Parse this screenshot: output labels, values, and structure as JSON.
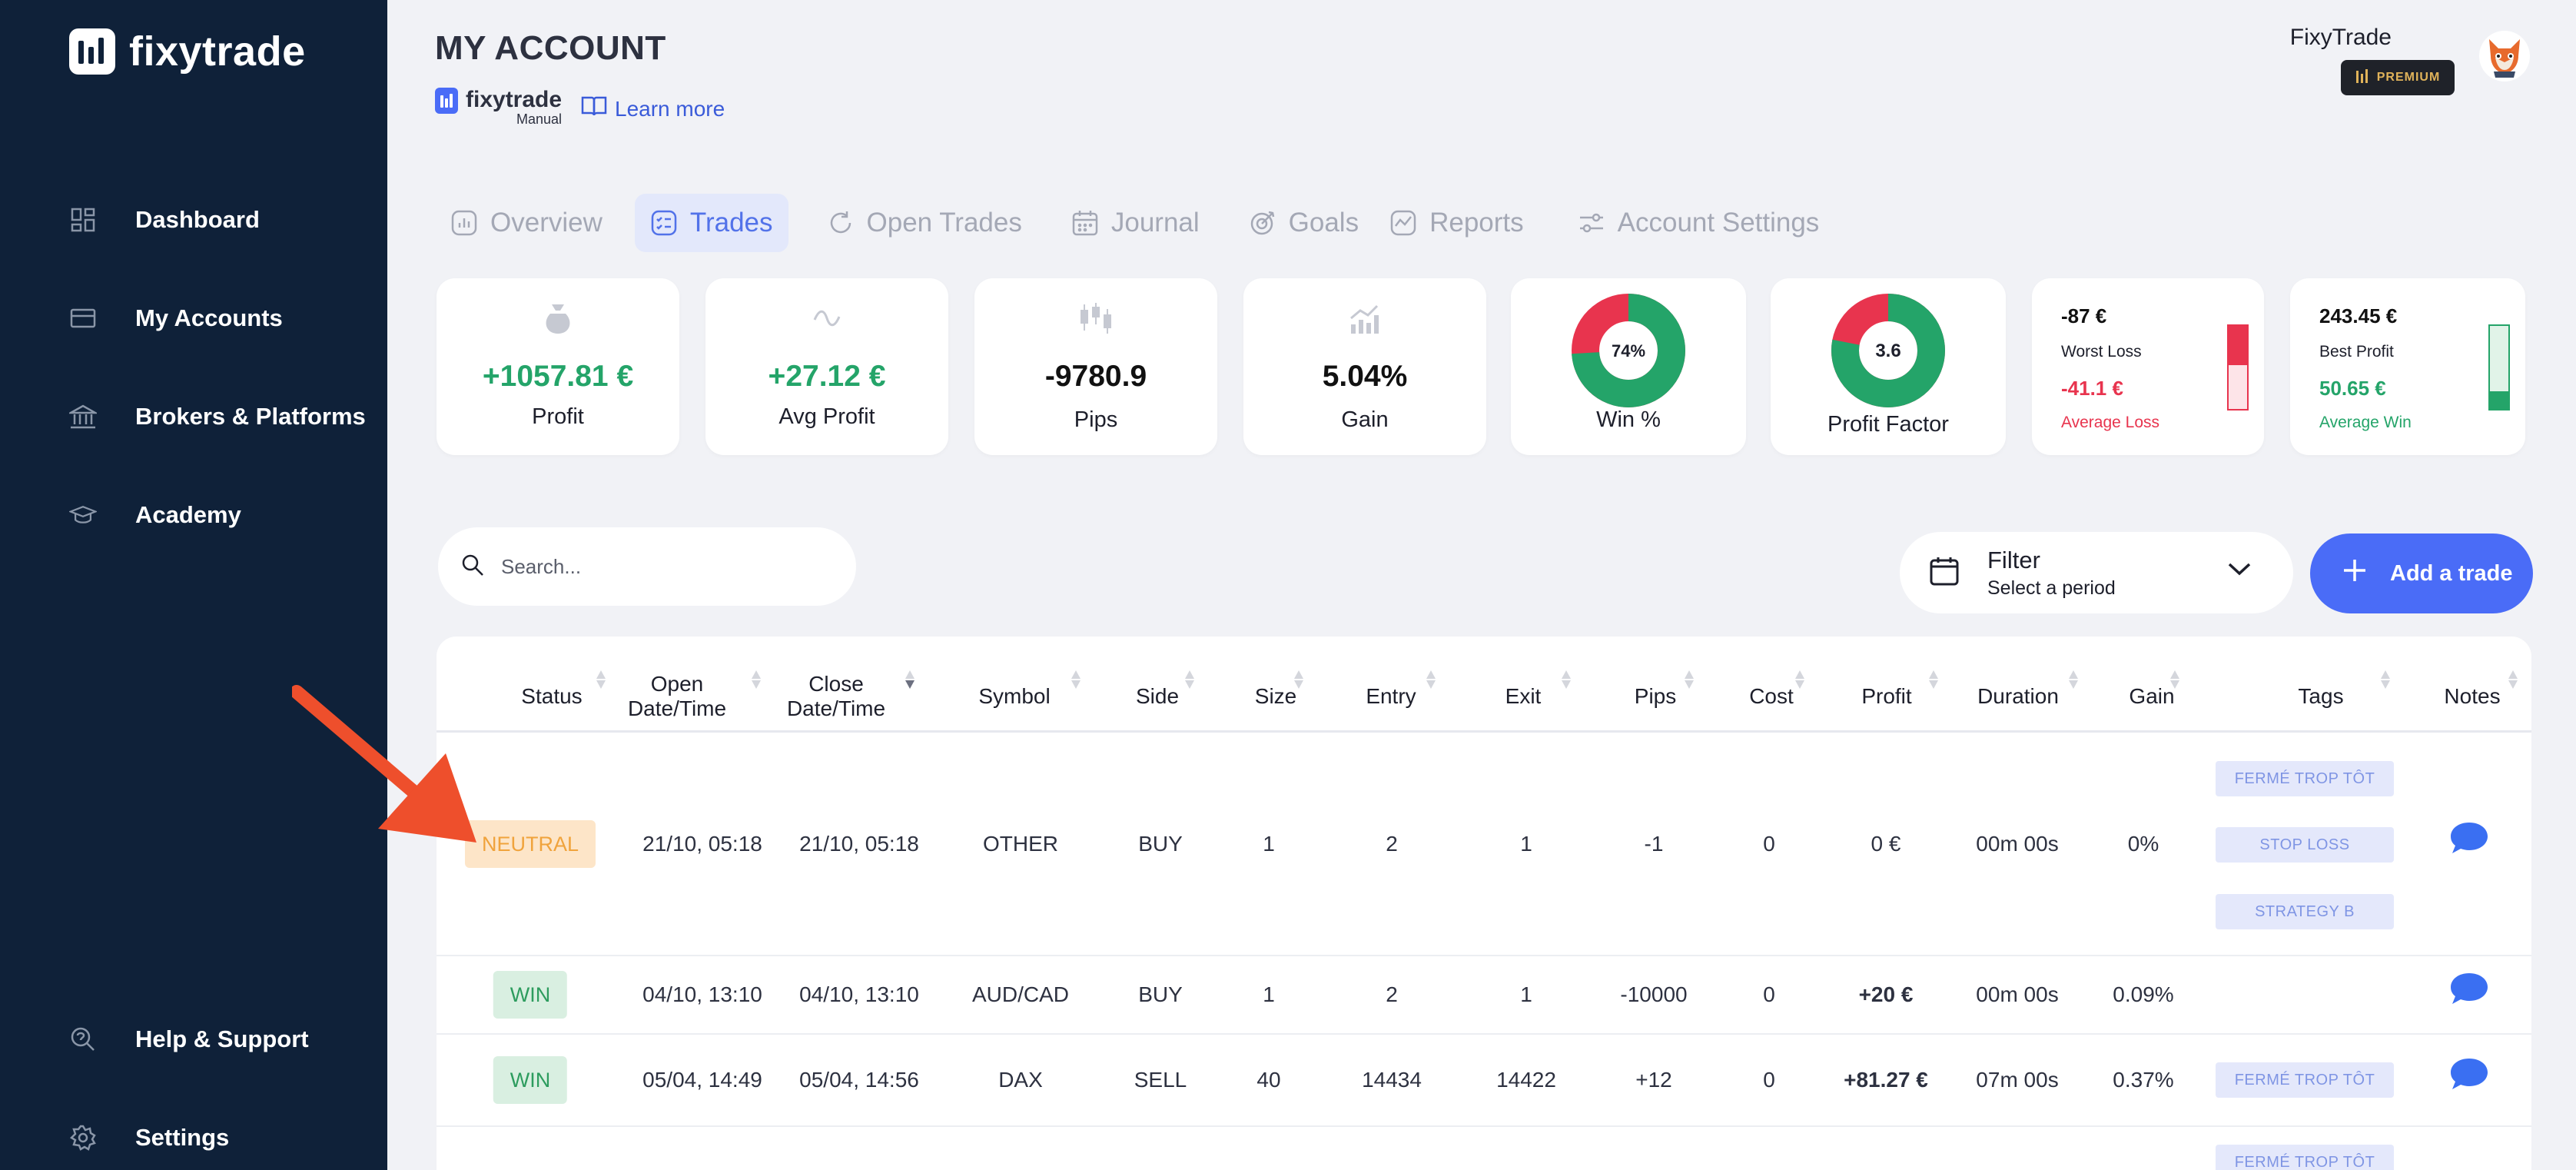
{
  "brand": {
    "name": "fixytrade"
  },
  "sidebar": {
    "items": [
      {
        "label": "Dashboard",
        "icon": "dashboard-icon"
      },
      {
        "label": "My Accounts",
        "icon": "accounts-icon"
      },
      {
        "label": "Brokers & Platforms",
        "icon": "bank-icon"
      },
      {
        "label": "Academy",
        "icon": "graduation-cap-icon"
      },
      {
        "label": "Help & Support",
        "icon": "support-icon"
      },
      {
        "label": "Settings",
        "icon": "gear-icon"
      }
    ]
  },
  "header": {
    "title": "MY ACCOUNT",
    "sub_brand_name": "fixytrade",
    "sub_brand_mode": "Manual",
    "learn_more": "Learn more",
    "user_name": "FixyTrade",
    "badge": "PREMIUM"
  },
  "tabs": [
    {
      "label": "Overview",
      "active": false
    },
    {
      "label": "Trades",
      "active": true
    },
    {
      "label": "Open Trades",
      "active": false
    },
    {
      "label": "Journal",
      "active": false
    },
    {
      "label": "Goals",
      "active": false
    },
    {
      "label": "Reports",
      "active": false
    },
    {
      "label": "Account Settings",
      "active": false
    }
  ],
  "stats": {
    "profit": {
      "value": "+1057.81 €",
      "label": "Profit"
    },
    "avg_profit": {
      "value": "+27.12 €",
      "label": "Avg Profit"
    },
    "pips": {
      "value": "-9780.9",
      "label": "Pips"
    },
    "gain": {
      "value": "5.04%",
      "label": "Gain"
    },
    "win_pct": {
      "value": "74%",
      "label": "Win %",
      "fraction": 0.74
    },
    "profit_factor": {
      "value": "3.6",
      "label": "Profit Factor",
      "fraction": 0.78
    },
    "worst_loss": {
      "value": "-87 €",
      "label": "Worst Loss",
      "avg_value": "-41.1 €",
      "avg_label": "Average Loss",
      "fill_fraction": 0.47
    },
    "best_profit": {
      "value": "243.45 €",
      "label": "Best Profit",
      "avg_value": "50.65 €",
      "avg_label": "Average Win",
      "fill_fraction": 0.21
    }
  },
  "toolbar": {
    "search_placeholder": "Search...",
    "filter_label": "Filter",
    "filter_sub": "Select a period",
    "add_label": "Add a trade"
  },
  "table": {
    "columns": [
      "Status",
      "Open Date/Time",
      "Close Date/Time",
      "Symbol",
      "Side",
      "Size",
      "Entry",
      "Exit",
      "Pips",
      "Cost",
      "Profit",
      "Duration",
      "Gain",
      "Tags",
      "Notes"
    ],
    "rows": [
      {
        "status": "NEUTRAL",
        "open": "21/10, 05:18",
        "close": "21/10, 05:18",
        "symbol": "OTHER",
        "side": "BUY",
        "size": "1",
        "entry": "2",
        "exit": "1",
        "pips": "-1",
        "cost": "0",
        "profit": "0 €",
        "duration": "00m 00s",
        "gain": "0%",
        "tags": [
          "FERMÉ TROP TÔT",
          "STOP LOSS",
          "STRATEGY B"
        ]
      },
      {
        "status": "WIN",
        "open": "04/10, 13:10",
        "close": "04/10, 13:10",
        "symbol": "AUD/CAD",
        "side": "BUY",
        "size": "1",
        "entry": "2",
        "exit": "1",
        "pips": "-10000",
        "cost": "0",
        "profit": "+20 €",
        "duration": "00m 00s",
        "gain": "0.09%",
        "tags": []
      },
      {
        "status": "WIN",
        "open": "05/04, 14:49",
        "close": "05/04, 14:56",
        "symbol": "DAX",
        "side": "SELL",
        "size": "40",
        "entry": "14434",
        "exit": "14422",
        "pips": "+12",
        "cost": "0",
        "profit": "+81.27 €",
        "duration": "07m 00s",
        "gain": "0.37%",
        "tags": [
          "FERMÉ TROP TÔT"
        ]
      }
    ],
    "partial_next_tag": "FERMÉ TROP TÔT"
  },
  "colors": {
    "sidebar": "#0f2139",
    "accent": "#4a6cf7",
    "green": "#24a469",
    "red": "#e8344e"
  }
}
